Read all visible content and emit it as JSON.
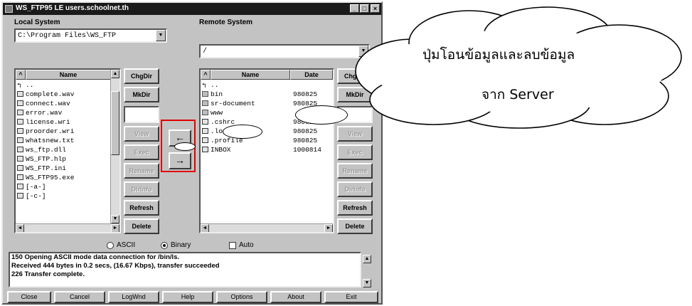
{
  "window": {
    "title": "WS_FTP95 LE  users.schoolnet.th",
    "controls": [
      "_",
      "□",
      "×"
    ]
  },
  "local": {
    "label": "Local System",
    "path": "C:\\Program Files\\WS_FTP",
    "col_name": "Name",
    "files": [
      {
        "name": "..",
        "icon": "up-arrow-icon"
      },
      {
        "name": "complete.wav",
        "icon": "file-icon"
      },
      {
        "name": "connect.wav",
        "icon": "file-icon"
      },
      {
        "name": "error.wav",
        "icon": "file-icon"
      },
      {
        "name": "license.wri",
        "icon": "file-icon"
      },
      {
        "name": "proorder.wri",
        "icon": "file-icon"
      },
      {
        "name": "whatsnew.txt",
        "icon": "file-icon"
      },
      {
        "name": "ws_ftp.dll",
        "icon": "file-icon"
      },
      {
        "name": "WS_FTP.hlp",
        "icon": "file-icon"
      },
      {
        "name": "WS_FTP.ini",
        "icon": "file-icon"
      },
      {
        "name": "WS_FTP95.exe",
        "icon": "file-icon"
      },
      {
        "name": "[-a-]",
        "icon": "drive-icon"
      },
      {
        "name": "[-c-]",
        "icon": "drive-icon"
      }
    ],
    "buttons": {
      "chgdir": "ChgDir",
      "mkdir": "MkDir",
      "view": "View",
      "exec": "Exec",
      "rename": "Rename",
      "delete_dis": "Delete",
      "refresh": "Refresh",
      "dirinfo": "DirInfo"
    }
  },
  "transfer": {
    "left_arrow": "←",
    "right_arrow": "→"
  },
  "remote": {
    "label": "Remote System",
    "path": "/",
    "col_name": "Name",
    "col_date": "Date",
    "files": [
      {
        "name": "..",
        "date": "",
        "icon": "up-arrow-icon"
      },
      {
        "name": "bin",
        "date": "980825",
        "icon": "folder-icon"
      },
      {
        "name": "sr-document",
        "date": "980825",
        "icon": "folder-icon"
      },
      {
        "name": "www",
        "date": "",
        "icon": "folder-icon"
      },
      {
        "name": ".cshrc",
        "date": "980825",
        "icon": "file-icon"
      },
      {
        "name": ".login",
        "date": "980825",
        "icon": "file-icon"
      },
      {
        "name": ".profile",
        "date": "980825",
        "icon": "file-icon"
      },
      {
        "name": "INBOX",
        "date": "1000814",
        "icon": "file-icon"
      }
    ],
    "buttons": {
      "chgdir": "ChgDir",
      "mkdir": "MkDir",
      "view": "View",
      "exec": "Exec",
      "rename": "Rename",
      "delete_dis": "Delete",
      "refresh": "Refresh",
      "dirinfo": "DirInfo"
    }
  },
  "mode": {
    "ascii": "ASCII",
    "binary": "Binary",
    "auto": "Auto",
    "selected": "binary"
  },
  "log": {
    "lines": [
      "150 Opening ASCII mode data connection for /bin/ls.",
      "Received 444 bytes in 0.2 secs, (16.67 Kbps), transfer succeeded",
      "226 Transfer complete."
    ]
  },
  "bottom": {
    "close": "Close",
    "cancel": "Cancel",
    "logwnd": "LogWnd",
    "help": "Help",
    "options": "Options",
    "about": "About",
    "exit": "Exit"
  },
  "callout": {
    "line1": "ปุ่มโอนข้อมูลและลบข้อมูล",
    "line2": "จาก Server"
  },
  "colors": {
    "window_bg": "#c3c3c3",
    "titlebar": "#1a1a1a",
    "highlight": "#e00000"
  }
}
